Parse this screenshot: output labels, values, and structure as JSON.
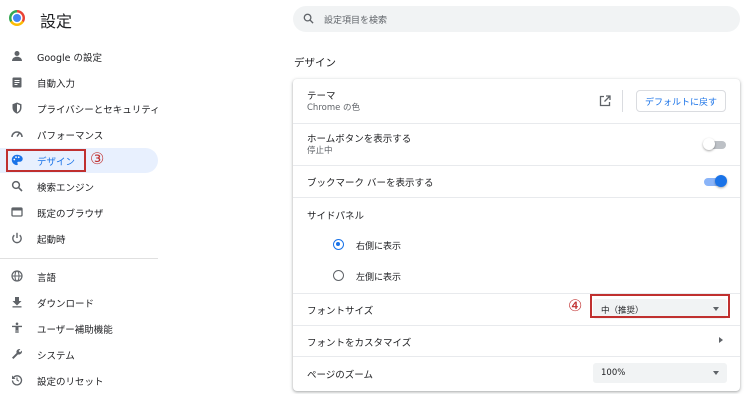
{
  "header": {
    "title": "設定",
    "search_placeholder": "設定項目を検索"
  },
  "sidebar": {
    "items": [
      {
        "label": "Google の設定",
        "icon": "person-icon"
      },
      {
        "label": "自動入力",
        "icon": "clipboard-icon"
      },
      {
        "label": "プライバシーとセキュリティ",
        "icon": "shield-icon"
      },
      {
        "label": "パフォーマンス",
        "icon": "speedometer-icon"
      },
      {
        "label": "デザイン",
        "icon": "palette-icon",
        "active": true
      },
      {
        "label": "検索エンジン",
        "icon": "search-icon"
      },
      {
        "label": "既定のブラウザ",
        "icon": "browser-window-icon"
      },
      {
        "label": "起動時",
        "icon": "power-icon"
      },
      {
        "label": "言語",
        "icon": "globe-icon"
      },
      {
        "label": "ダウンロード",
        "icon": "download-icon"
      },
      {
        "label": "ユーザー補助機能",
        "icon": "accessibility-icon"
      },
      {
        "label": "システム",
        "icon": "wrench-icon"
      },
      {
        "label": "設定のリセット",
        "icon": "reset-icon"
      }
    ]
  },
  "annotations": {
    "step3": "③",
    "step4": "④",
    "color": "#c0302f"
  },
  "main": {
    "section_title": "デザイン",
    "theme": {
      "label": "テーマ",
      "sub": "Chrome の色",
      "reset_button": "デフォルトに戻す"
    },
    "home_button": {
      "label": "ホームボタンを表示する",
      "sub": "停止中",
      "enabled": false
    },
    "bookmark_bar": {
      "label": "ブックマーク バーを表示する",
      "enabled": true
    },
    "side_panel": {
      "label": "サイドパネル",
      "options": [
        {
          "label": "右側に表示",
          "checked": true
        },
        {
          "label": "左側に表示",
          "checked": false
        }
      ]
    },
    "font_size": {
      "label": "フォントサイズ",
      "value": "中（推奨）"
    },
    "customize_fonts": {
      "label": "フォントをカスタマイズ"
    },
    "page_zoom": {
      "label": "ページのズーム",
      "value": "100%"
    }
  },
  "colors": {
    "accent": "#1a73e8",
    "active_bg": "#e8f0fe"
  }
}
